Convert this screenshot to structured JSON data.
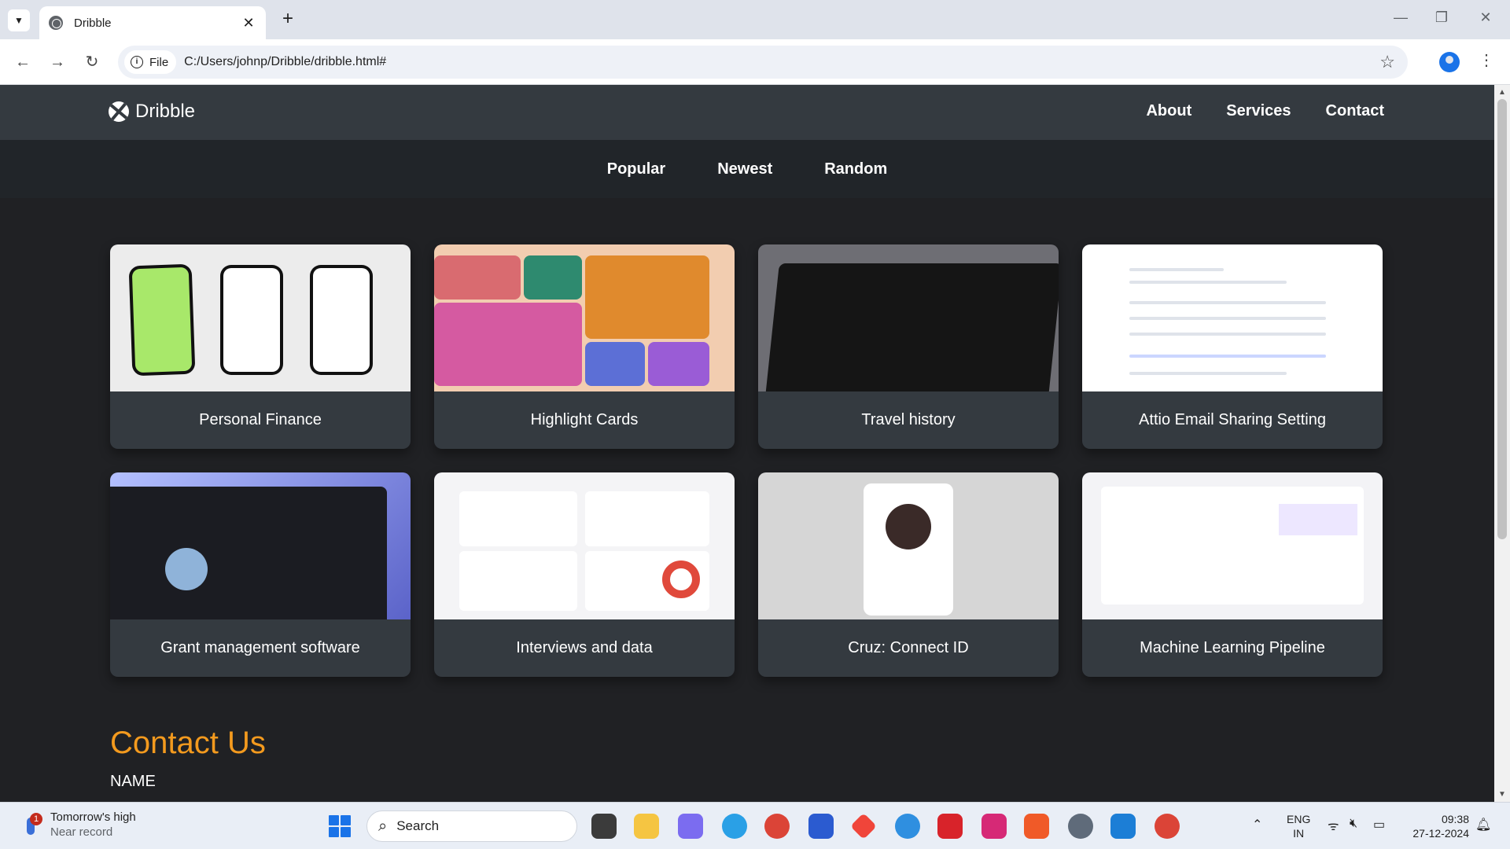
{
  "browser": {
    "tab_title": "Dribble",
    "file_label": "File",
    "url": "C:/Users/johnp/Dribble/dribble.html#"
  },
  "site": {
    "brand": "Dribble",
    "nav": [
      "About",
      "Services",
      "Contact"
    ],
    "filters": [
      "Popular",
      "Newest",
      "Random"
    ],
    "cards": [
      {
        "title": "Personal Finance"
      },
      {
        "title": "Highlight Cards"
      },
      {
        "title": "Travel history"
      },
      {
        "title": "Attio Email Sharing Setting"
      },
      {
        "title": "Grant management software"
      },
      {
        "title": "Interviews and data"
      },
      {
        "title": "Cruz: Connect ID"
      },
      {
        "title": "Machine Learning Pipeline"
      }
    ],
    "contact_heading": "Contact Us",
    "name_label": "NAME"
  },
  "taskbar": {
    "weather_title": "Tomorrow's high",
    "weather_sub": "Near record",
    "weather_badge": "1",
    "search_label": "Search",
    "lang_1": "ENG",
    "lang_2": "IN",
    "time": "09:38",
    "date": "27-12-2024"
  },
  "colors": {
    "header": "#343a40",
    "subnav": "#212529",
    "page": "#202124",
    "accent": "#f39a1e"
  }
}
